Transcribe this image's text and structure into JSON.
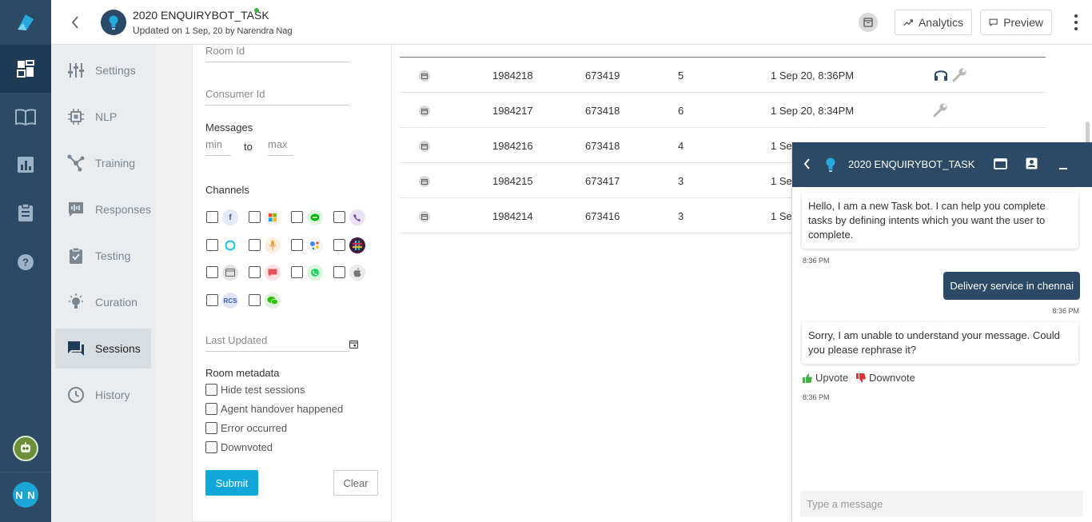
{
  "header": {
    "bot_name": "2020 ENQUIRYBOT_TASK",
    "updated_prefix": "Updated on",
    "updated_date": "1 Sep, 20",
    "updated_by": "by Narendra Nag",
    "analytics_label": "Analytics",
    "preview_label": "Preview"
  },
  "rail": {
    "user_initials": "N N"
  },
  "subnav": {
    "items": [
      {
        "label": "Settings",
        "icon": "sliders-icon"
      },
      {
        "label": "NLP",
        "icon": "chip-icon"
      },
      {
        "label": "Training",
        "icon": "network-icon"
      },
      {
        "label": "Responses",
        "icon": "waveform-chat-icon"
      },
      {
        "label": "Testing",
        "icon": "clipboard-check-icon"
      },
      {
        "label": "Curation",
        "icon": "bulb-icon"
      },
      {
        "label": "Sessions",
        "icon": "chat-bubble-icon"
      },
      {
        "label": "History",
        "icon": "history-icon"
      }
    ]
  },
  "filter": {
    "room_id_placeholder": "Room Id",
    "consumer_id_placeholder": "Consumer Id",
    "messages_label": "Messages",
    "min_placeholder": "min",
    "to_label": "to",
    "max_placeholder": "max",
    "channels_label": "Channels",
    "rcs_label": "RCS",
    "last_updated_placeholder": "Last Updated",
    "room_metadata_label": "Room metadata",
    "metadata_options": [
      "Hide test sessions",
      "Agent handover happened",
      "Error occurred",
      "Downvoted"
    ],
    "submit_label": "Submit",
    "clear_label": "Clear"
  },
  "table": {
    "rows": [
      {
        "session": "1984218",
        "room": "673419",
        "messages": "5",
        "updated": "1 Sep 20, 8:36PM"
      },
      {
        "session": "1984217",
        "room": "673418",
        "messages": "6",
        "updated": "1 Sep 20, 8:34PM"
      },
      {
        "session": "1984216",
        "room": "673418",
        "messages": "4",
        "updated": "1 Se"
      },
      {
        "session": "1984215",
        "room": "673417",
        "messages": "3",
        "updated": "1 Se"
      },
      {
        "session": "1984214",
        "room": "673416",
        "messages": "3",
        "updated": "1 Se"
      }
    ]
  },
  "chat": {
    "title": "2020 ENQUIRYBOT_TASK",
    "bot_msg_1": "Hello, I am a new Task bot. I can help you complete tasks by defining intents which you want the user to complete.",
    "time_1": "8:36 PM",
    "user_msg": "Delivery service in chennai",
    "time_2": "8:36 PM",
    "bot_msg_2": "Sorry, I am unable to understand your message. Could you please rephrase it?",
    "upvote_label": "Upvote",
    "downvote_label": "Downvote",
    "time_3": "8:36 PM",
    "input_placeholder": "Type a message"
  },
  "colors": {
    "rail_bg": "#2c4a66",
    "accent": "#12a7d9",
    "upvote": "#3fb24a",
    "downvote": "#d9343b"
  }
}
